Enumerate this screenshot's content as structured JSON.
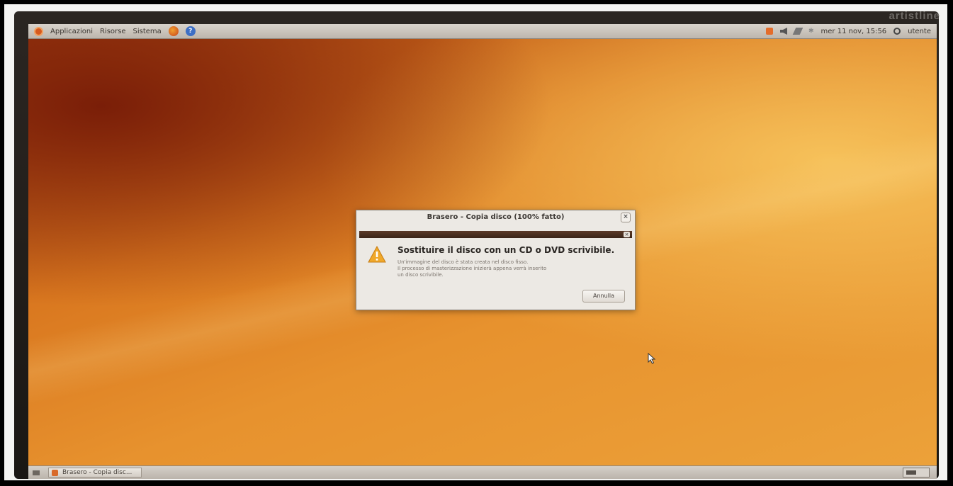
{
  "brand": "artistline",
  "top_panel": {
    "menu": [
      "Applicazioni",
      "Risorse",
      "Sistema"
    ],
    "clock": "mer 11 nov, 15:56",
    "user": "utente"
  },
  "dialog": {
    "title": "Brasero - Copia disco (100% fatto)",
    "heading": "Sostituire il disco con un CD o DVD scrivibile.",
    "body_lines": [
      "Un'immagine del disco è stata creata nel disco fisso.",
      "Il processo di masterizzazione inizierà appena verrà inserito",
      "un disco scrivibile."
    ],
    "cancel_label": "Annulla",
    "close_glyph": "×"
  },
  "bottom_panel": {
    "task_label": "Brasero - Copia disc..."
  },
  "colors": {
    "wallpaper_dark": "#7a1e08",
    "wallpaper_light": "#eca23a",
    "panel": "#d8d3cc",
    "dialog_bg": "#ece9e4"
  }
}
